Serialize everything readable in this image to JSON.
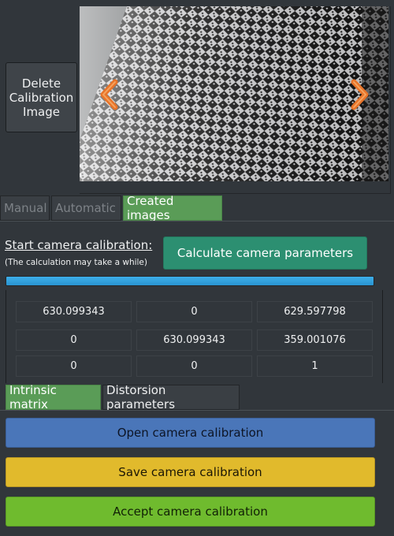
{
  "image_viewer": {
    "delete_label": "Delete Calibration Image",
    "prev_icon": "chevron-left-icon",
    "next_icon": "chevron-right-icon",
    "accent_color": "#e8742a"
  },
  "mode_tabs": [
    {
      "label": "Manual",
      "active": false
    },
    {
      "label": "Automatic",
      "active": false
    },
    {
      "label": "Created images",
      "active": true
    }
  ],
  "calibration": {
    "start_label": "Start camera calibration:",
    "note": "(The calculation may take a while)",
    "calculate_label": "Calculate camera parameters",
    "progress": 1.0
  },
  "matrix": {
    "rows": [
      [
        "630.099343",
        "0",
        "629.597798"
      ],
      [
        "0",
        "630.099343",
        "359.001076"
      ],
      [
        "0",
        "0",
        "1"
      ]
    ]
  },
  "result_tabs": [
    {
      "label": "Intrinsic matrix",
      "active": true
    },
    {
      "label": "Distorsion parameters",
      "active": false
    }
  ],
  "actions": {
    "open_label": "Open camera calibration",
    "save_label": "Save camera calibration",
    "accept_label": "Accept camera calibration"
  },
  "colors": {
    "open": "#4a76b9",
    "save": "#e1ba2c",
    "accept": "#6fbb2e",
    "active_tab": "#5a9c57",
    "calculate": "#2c8f71"
  }
}
